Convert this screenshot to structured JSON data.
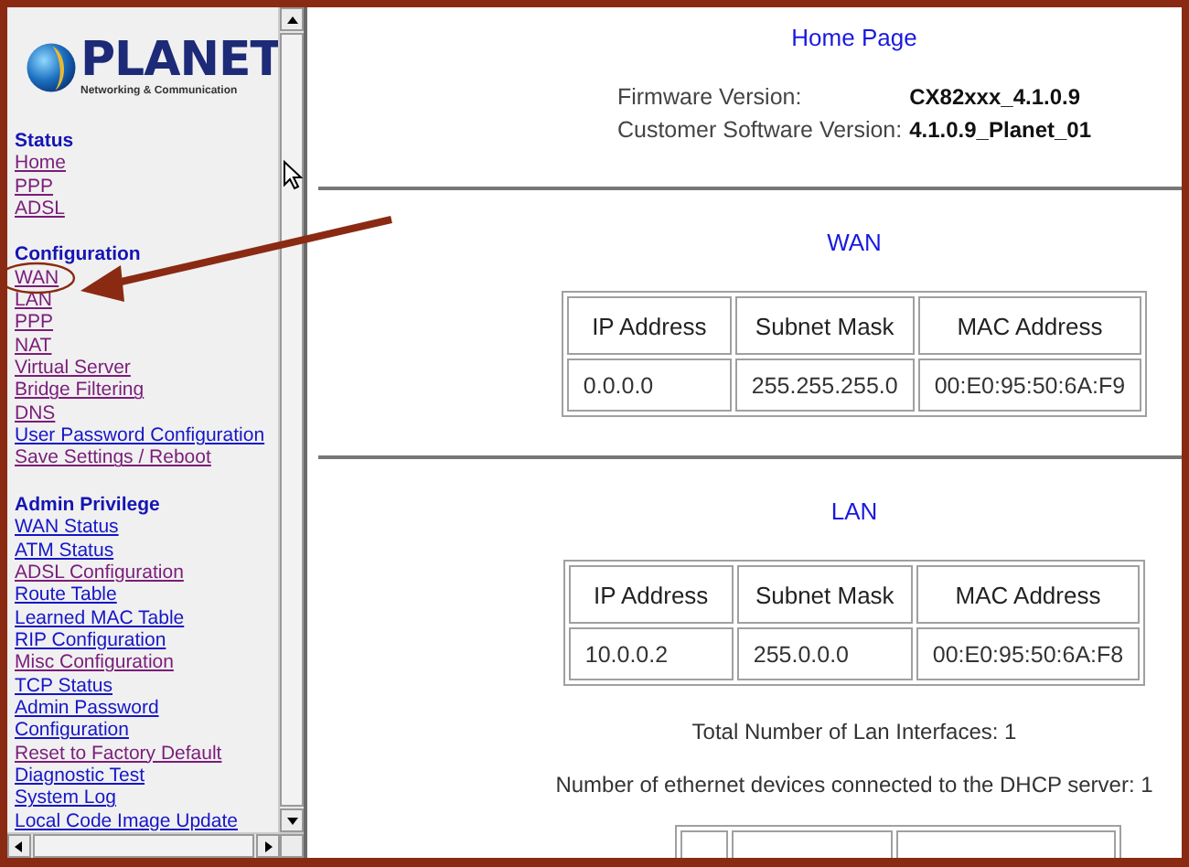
{
  "logo": {
    "brand": "PLANET",
    "tagline": "Networking & Communication"
  },
  "sidebar": {
    "sections": [
      {
        "title": "Status",
        "links": [
          {
            "label": "Home",
            "visited": true
          },
          {
            "label": "PPP",
            "visited": true
          },
          {
            "label": "ADSL",
            "visited": true
          }
        ]
      },
      {
        "title": "Configuration",
        "links": [
          {
            "label": "WAN",
            "visited": true
          },
          {
            "label": "LAN",
            "visited": true
          },
          {
            "label": "PPP",
            "visited": true
          },
          {
            "label": "NAT",
            "visited": true
          },
          {
            "label": "Virtual Server",
            "visited": true
          },
          {
            "label": "Bridge Filtering",
            "visited": true
          },
          {
            "label": "DNS",
            "visited": true
          },
          {
            "label": "User Password Configuration",
            "visited": false
          },
          {
            "label": "Save Settings / Reboot",
            "visited": true
          }
        ]
      },
      {
        "title": "Admin Privilege",
        "links": [
          {
            "label": "WAN Status",
            "visited": false
          },
          {
            "label": "ATM Status",
            "visited": false
          },
          {
            "label": "ADSL Configuration",
            "visited": true
          },
          {
            "label": "Route Table",
            "visited": false
          },
          {
            "label": "Learned MAC Table",
            "visited": false
          },
          {
            "label": "RIP Configuration",
            "visited": false
          },
          {
            "label": "Misc Configuration",
            "visited": true
          },
          {
            "label": "TCP Status",
            "visited": false
          },
          {
            "label": "Admin Password Configuration",
            "visited": false
          },
          {
            "label": "Reset to Factory Default",
            "visited": true
          },
          {
            "label": "Diagnostic Test",
            "visited": false
          },
          {
            "label": "System Log",
            "visited": false
          },
          {
            "label": "Local Code Image Update",
            "visited": false
          }
        ]
      }
    ]
  },
  "main": {
    "title": "Home Page",
    "versions": [
      {
        "label": "Firmware Version:",
        "value": "CX82xxx_4.1.0.9"
      },
      {
        "label": "Customer Software Version:",
        "value": "4.1.0.9_Planet_01"
      }
    ],
    "sections": [
      {
        "title": "WAN",
        "table": {
          "columns": [
            "IP Address",
            "Subnet Mask",
            "MAC Address"
          ],
          "rows": [
            [
              "0.0.0.0",
              "255.255.255.0",
              "00:E0:95:50:6A:F9"
            ]
          ]
        }
      },
      {
        "title": "LAN",
        "table": {
          "columns": [
            "IP Address",
            "Subnet Mask",
            "MAC Address"
          ],
          "rows": [
            [
              "10.0.0.2",
              "255.0.0.0",
              "00:E0:95:50:6A:F8"
            ]
          ]
        },
        "notes": [
          "Total Number of Lan Interfaces: 1",
          "Number of ethernet devices connected to the DHCP server: 1"
        ]
      }
    ]
  }
}
